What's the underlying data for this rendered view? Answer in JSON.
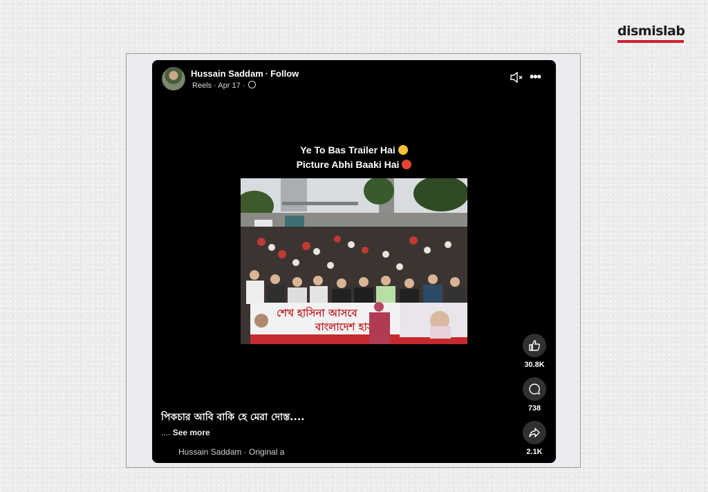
{
  "brand": {
    "name": "dismislab",
    "accent": "#d0202a"
  },
  "post": {
    "author": "Hussain Saddam",
    "follow_label": "Follow",
    "meta": "Reels · Apr 17 ·",
    "privacy_icon": "globe-icon",
    "overlay_line1": "Ye To Bas Trailer Hai",
    "overlay_line2": "Picture Abhi Baaki Hai",
    "caption": "পিকচার আবি বাকি হে মেরা দোস্ত....",
    "see_more_prefix": "....",
    "see_more_label": "See more",
    "audio": "Hussain Saddam · Original a"
  },
  "banner": {
    "line1": "শেখ হাসিনা আসবে",
    "line2": "বাংলাদেশ হাসবে"
  },
  "actions": {
    "likes": "30.8K",
    "comments": "738",
    "shares": "2.1K"
  },
  "icons": [
    "mute-icon",
    "more-icon",
    "like-icon",
    "comment-icon",
    "share-icon"
  ]
}
